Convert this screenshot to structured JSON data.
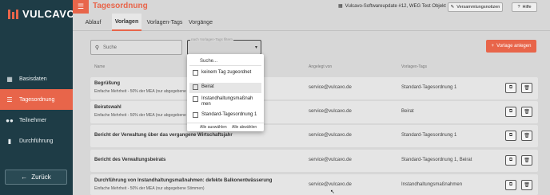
{
  "app": {
    "logo_text": "VULCAVO",
    "title": "Tagesordnung"
  },
  "header": {
    "project": "Vulcavo-Softwareupdate #12, WEG Test Objekt",
    "notes_button": "Versammlungsnotizen",
    "help_button": "Hilfe"
  },
  "sidebar": {
    "items": [
      {
        "label": "Basisdaten",
        "icon": "building-icon"
      },
      {
        "label": "Tagesordnung",
        "icon": "list-icon",
        "active": true
      },
      {
        "label": "Teilnehmer",
        "icon": "people-icon"
      },
      {
        "label": "Durchführung",
        "icon": "chart-icon"
      }
    ],
    "back_label": "Zurück"
  },
  "tabs": [
    "Ablauf",
    "Vorlagen",
    "Vorlagen-Tags",
    "Vorgänge"
  ],
  "toolbar": {
    "search_placeholder": "Suche",
    "filter_label": "nach Vorlagen-Tags filtern",
    "add_button": "Vorlage anlegen"
  },
  "table": {
    "headers": {
      "name": "Name",
      "created_by": "Angelegt von",
      "tags": "Vorlagen-Tags"
    },
    "rows": [
      {
        "title": "Begrüßung",
        "subtitle": "Einfache Mehrheit - 50% der MEA (nur abgegebene Stimmen)",
        "email": "service@vulcavo.de",
        "tag": "Standard-Tagesordnung 1"
      },
      {
        "title": "Beiratswahl",
        "subtitle": "Einfache Mehrheit - 50% der MEA (nur abgegebene Stimmen)",
        "email": "service@vulcavo.de",
        "tag": "Beirat"
      },
      {
        "title": "Bericht der Verwaltung über das vergangene Wirtschaftsjahr",
        "subtitle": "",
        "email": "service@vulcavo.de",
        "tag": "Standard-Tagesordnung 1"
      },
      {
        "title": "Bericht des Verwaltungsbeirats",
        "subtitle": "",
        "email": "service@vulcavo.de",
        "tag": "Standard-Tagesordnung 1, Beirat"
      },
      {
        "title": "Durchführung von Instandhaltungsmaßnahmen: defekte Balkonentwässerung",
        "subtitle": "Einfache Mehrheit - 50% der MEA (nur abgegebene Stimmen)",
        "email": "service@vulcavo.de",
        "tag": "Instandhaltungsmaßnahmen"
      }
    ]
  },
  "dropdown": {
    "search_placeholder": "Suche...",
    "options": [
      "keinem Tag zugeordnet",
      "Beirat",
      "Instandhaltungsmaßnahmen",
      "Standard-Tagesordnung 1"
    ],
    "select_all": "Alle auswählen",
    "deselect_all": "Alle abwählen"
  },
  "colors": {
    "accent": "#e8654a",
    "sidebar": "#1e3c46"
  }
}
